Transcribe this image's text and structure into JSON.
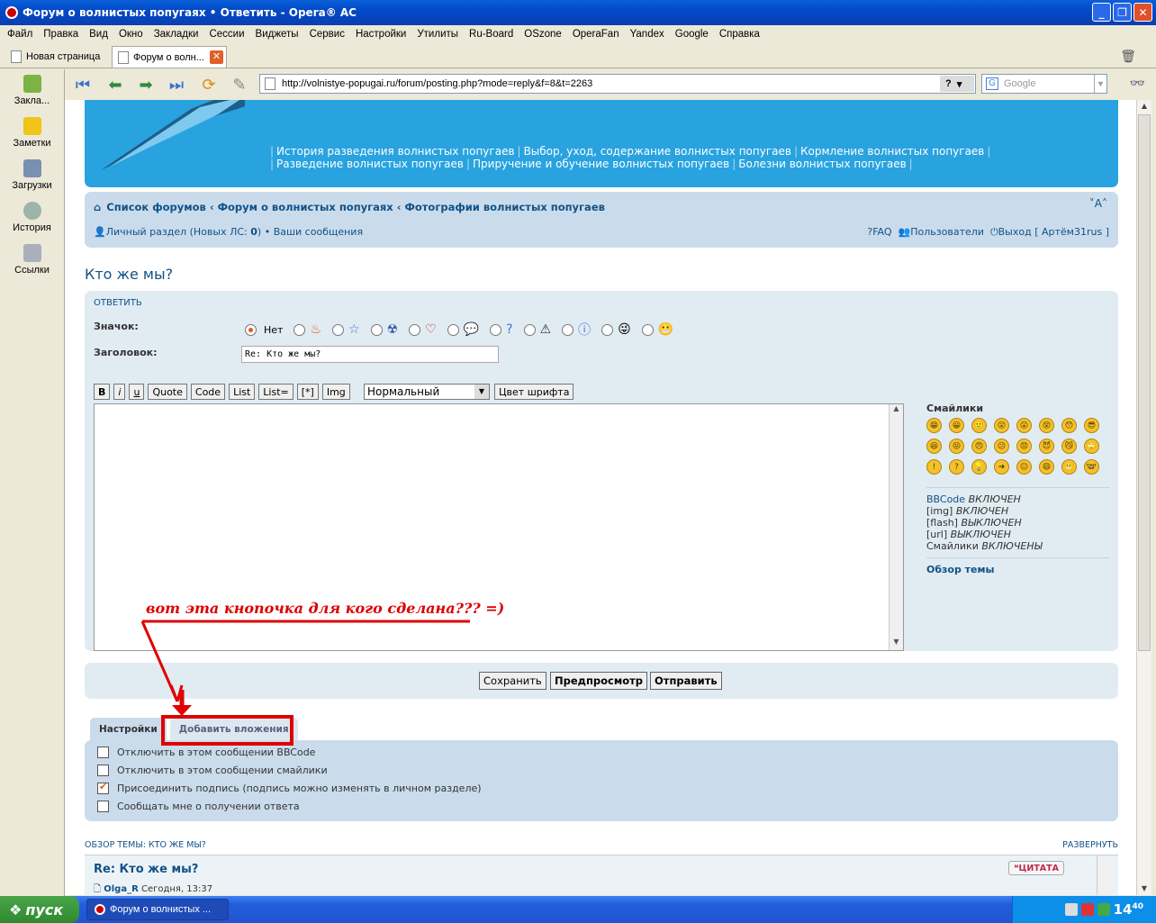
{
  "window": {
    "title": "Форум о волнистых попугаях • Ответить - Opera® AC"
  },
  "menu": [
    "Файл",
    "Правка",
    "Вид",
    "Окно",
    "Закладки",
    "Сессии",
    "Виджеты",
    "Сервис",
    "Настройки",
    "Утилиты",
    "Ru-Board",
    "OSzone",
    "OperaFan",
    "Yandex",
    "Google",
    "Справка"
  ],
  "tabs": [
    {
      "label": "Новая страница"
    },
    {
      "label": "Форум о волн..."
    }
  ],
  "sidebar": [
    {
      "label": "Закла..."
    },
    {
      "label": "Заметки"
    },
    {
      "label": "Загрузки"
    },
    {
      "label": "История"
    },
    {
      "label": "Ссылки"
    }
  ],
  "address": {
    "url": "http://volnistye-popugai.ru/forum/posting.php?mode=reply&f=8&t=2263",
    "help": "?"
  },
  "search": {
    "placeholder": "Google"
  },
  "header": {
    "links_row1": [
      "История разведения волнистых попугаев",
      "Выбор, уход, содержание волнистых попугаев",
      "Кормление волнистых попугаев"
    ],
    "links_row2": [
      "Разведение волнистых попугаев",
      "Приручение и обучение волнистых попугаев",
      "Болезни волнистых попугаев"
    ]
  },
  "breadcrumbs": [
    "Список форумов",
    "Форум о волнистых попугаях",
    "Фотографии волнистых попугаев"
  ],
  "fontsize": "˅A˄",
  "ucp": {
    "left_prefix": "Личный раздел (Новых ЛС: ",
    "left_count": "0",
    "left_suffix": ")",
    "messages": "Ваши сообщения",
    "faq": "FAQ",
    "users": "Пользователи",
    "logout": "Выход [ Артём31rus ]"
  },
  "page_title": "Кто же мы?",
  "form": {
    "panel_title": "ОТВЕТИТЬ",
    "icon_label": "Значок:",
    "icon_none": "Нет",
    "subject_label": "Заголовок:",
    "subject_value": "Re: Кто же мы?"
  },
  "bbcode": {
    "buttons": [
      "B",
      "i",
      "u",
      "Quote",
      "Code",
      "List",
      "List=",
      "[*]",
      "Img"
    ],
    "size": "Нормальный",
    "color": "Цвет шрифта"
  },
  "smilies": {
    "title": "Смайлики",
    "faces": [
      "😁",
      "😀",
      "🙂",
      "😮",
      "😲",
      "😵",
      "😯",
      "😎",
      "😆",
      "😝",
      "😠",
      "😕",
      "😟",
      "😈",
      "😼",
      "🙄",
      "!",
      "?",
      "💡",
      "➜",
      "😐",
      "😄",
      "😬",
      "🤓"
    ]
  },
  "status": {
    "bbcode": "BBCode",
    "bbcode_v": "ВКЛЮЧЕН",
    "img": "[img]",
    "img_v": "ВКЛЮЧЕН",
    "flash": "[flash]",
    "flash_v": "ВЫКЛЮЧЕН",
    "url": "[url]",
    "url_v": "ВЫКЛЮЧЕН",
    "smilies": "Смайлики",
    "smilies_v": "ВКЛЮЧЕНЫ",
    "overview": "Обзор темы"
  },
  "buttons": {
    "save": "Сохранить",
    "preview": "Предпросмотр",
    "submit": "Отправить"
  },
  "opttabs": {
    "settings": "Настройки",
    "attach": "Добавить вложения"
  },
  "options": [
    {
      "label": "Отключить в этом сообщении BBCode",
      "checked": false
    },
    {
      "label": "Отключить в этом сообщении смайлики",
      "checked": false
    },
    {
      "label": "Присоединить подпись (подпись можно изменять в личном разделе)",
      "checked": true
    },
    {
      "label": "Сообщать мне о получении ответа",
      "checked": false
    }
  ],
  "overview": {
    "header": "ОБЗОР ТЕМЫ: КТО ЖЕ МЫ?",
    "expand": "РАЗВЕРНУТЬ",
    "post_title": "Re: Кто же мы?",
    "author": "Olga_R",
    "time": "Сегодня, 13:37",
    "quote": "❝ЦИТАТА"
  },
  "annotation": "вот эта кнопочка для кого сделана??? =)",
  "taskbar": {
    "start": "пуск",
    "task": "Форум о волнистых ...",
    "clock": "14",
    "clock_small": "40"
  }
}
